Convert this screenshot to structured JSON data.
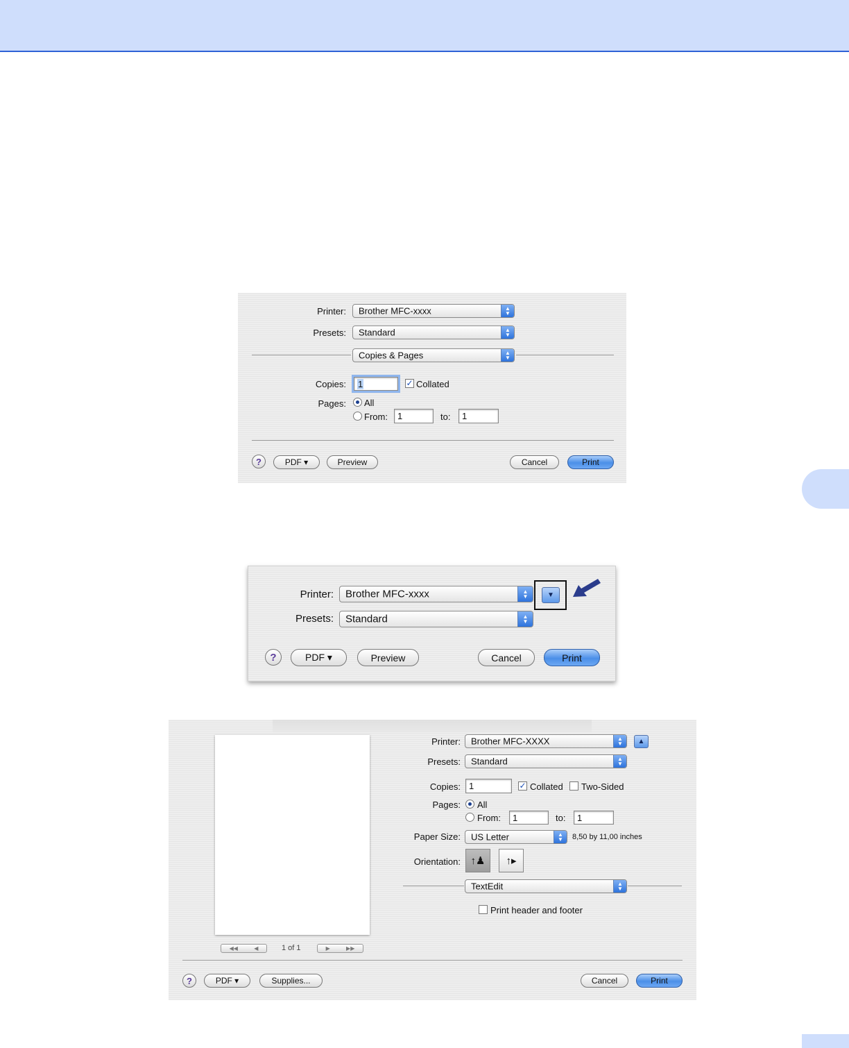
{
  "dialog1": {
    "printer_label": "Printer:",
    "printer_value": "Brother MFC-xxxx",
    "presets_label": "Presets:",
    "presets_value": "Standard",
    "panel_value": "Copies & Pages",
    "copies_label": "Copies:",
    "copies_value": "1",
    "collated_label": "Collated",
    "collated_checked": true,
    "pages_label": "Pages:",
    "all_label": "All",
    "from_label": "From:",
    "from_value": "1",
    "to_label": "to:",
    "to_value": "1",
    "pdf_label": "PDF ▾",
    "preview_label": "Preview",
    "cancel_label": "Cancel",
    "print_label": "Print"
  },
  "dialog2": {
    "printer_label": "Printer:",
    "printer_value": "Brother MFC-xxxx",
    "presets_label": "Presets:",
    "presets_value": "Standard",
    "pdf_label": "PDF ▾",
    "preview_label": "Preview",
    "cancel_label": "Cancel",
    "print_label": "Print"
  },
  "dialog3": {
    "printer_label": "Printer:",
    "printer_value": "Brother MFC-XXXX",
    "presets_label": "Presets:",
    "presets_value": "Standard",
    "copies_label": "Copies:",
    "copies_value": "1",
    "collated_label": "Collated",
    "collated_checked": true,
    "two_sided_label": "Two-Sided",
    "two_sided_checked": false,
    "pages_label": "Pages:",
    "all_label": "All",
    "from_label": "From:",
    "from_value": "1",
    "to_label": "to:",
    "to_value": "1",
    "paper_size_label": "Paper Size:",
    "paper_size_value": "US Letter",
    "paper_dimensions": "8,50 by 11,00 inches",
    "orientation_label": "Orientation:",
    "app_panel_value": "TextEdit",
    "header_footer_label": "Print header and footer",
    "header_footer_checked": false,
    "page_counter": "1 of 1",
    "pdf_label": "PDF ▾",
    "supplies_label": "Supplies...",
    "cancel_label": "Cancel",
    "print_label": "Print"
  },
  "colors": {
    "band": "#cfdefc",
    "band_rule": "#2f62d6",
    "highlight_arrow": "#2a3c8c"
  }
}
